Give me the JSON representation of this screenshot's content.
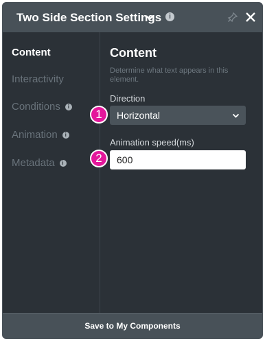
{
  "header": {
    "title": "Two Side Section Settings",
    "info_glyph": "i"
  },
  "sidebar": {
    "items": [
      {
        "label": "Content",
        "active": true,
        "has_info": false
      },
      {
        "label": "Interactivity",
        "active": false,
        "has_info": false
      },
      {
        "label": "Conditions",
        "active": false,
        "has_info": true
      },
      {
        "label": "Animation",
        "active": false,
        "has_info": true
      },
      {
        "label": "Metadata",
        "active": false,
        "has_info": true
      }
    ]
  },
  "content": {
    "title": "Content",
    "description": "Determine what text appears in this element.",
    "direction": {
      "label": "Direction",
      "value": "Horizontal"
    },
    "speed": {
      "label": "Animation speed(ms)",
      "value": "600"
    }
  },
  "callouts": {
    "one": "1",
    "two": "2"
  },
  "footer": {
    "save_label": "Save to My Components"
  },
  "colors": {
    "panel": "#2b3137",
    "header": "#485158",
    "badge": "#e4179b"
  }
}
